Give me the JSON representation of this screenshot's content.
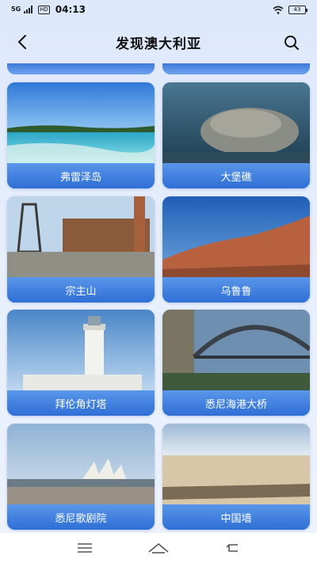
{
  "status_bar": {
    "signal": "5G",
    "hd": "HD",
    "time": "04:13",
    "battery": "43"
  },
  "header": {
    "title": "发现澳大利亚",
    "back_icon": "chevron-left-icon",
    "search_icon": "search-icon"
  },
  "places": [
    {
      "name": "弗雷泽岛"
    },
    {
      "name": "大堡礁"
    },
    {
      "name": "宗主山"
    },
    {
      "name": "乌鲁鲁"
    },
    {
      "name": "拜伦角灯塔"
    },
    {
      "name": "悉尼海港大桥"
    },
    {
      "name": "悉尼歌剧院"
    },
    {
      "name": "中国墙"
    }
  ],
  "colors": {
    "accent": "#3d7ad8",
    "label_top": "#5a96ea",
    "label_bottom": "#2f6fd6",
    "background": "#e6eefc"
  },
  "nav": {
    "menu_icon": "menu-icon",
    "home_icon": "home-icon",
    "back_icon": "back-arrow-icon"
  }
}
